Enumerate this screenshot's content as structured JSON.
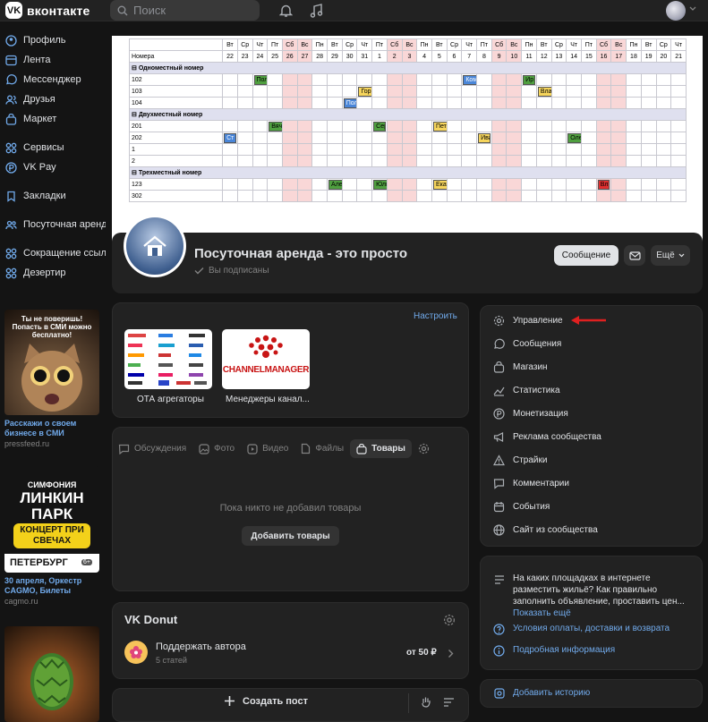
{
  "topbar": {
    "logo_letter": "VK",
    "logo_text": "вконтакте",
    "search_placeholder": "Поиск"
  },
  "sidebar": {
    "items": [
      {
        "label": "Профиль",
        "icon": "profile-icon"
      },
      {
        "label": "Лента",
        "icon": "feed-icon"
      },
      {
        "label": "Мессенджер",
        "icon": "messenger-icon"
      },
      {
        "label": "Друзья",
        "icon": "friends-icon"
      },
      {
        "label": "Маркет",
        "icon": "market-icon"
      },
      {
        "label": "Сервисы",
        "icon": "services-icon"
      },
      {
        "label": "VK Pay",
        "icon": "vkpay-icon"
      },
      {
        "label": "Закладки",
        "icon": "bookmark-icon"
      },
      {
        "label": "Посуточная аренда",
        "icon": "community-icon"
      },
      {
        "label": "Сокращение ссылок",
        "icon": "shortlink-icon"
      },
      {
        "label": "Дезертир",
        "icon": "apps-icon"
      }
    ]
  },
  "ads": [
    {
      "image_text": "Ты не поверишь! Попасть в СМИ можно бесплатно!",
      "title": "Расскажи о своем бизнесе в СМИ",
      "domain": "pressfeed.ru"
    },
    {
      "image_text": {
        "line1": "СИМФОНИЯ",
        "line2": "ЛИНКИН",
        "line3": "ПАРК",
        "line4": "КОНЦЕРТ ПРИ СВЕЧАХ",
        "line5": "ПЕТЕРБУРГ",
        "age": "6+"
      },
      "title": "30 апреля, Оркестр CAGMO, Билеты",
      "domain": "cagmo.ru"
    }
  ],
  "calendar": {
    "weekdays": [
      "Вт",
      "Ср",
      "Чт",
      "Пт",
      "Сб",
      "Вс",
      "Пн",
      "Вт",
      "Ср",
      "Чт",
      "Пт",
      "Сб",
      "Вс",
      "Пн",
      "Вт",
      "Ср",
      "Чт",
      "Пт",
      "Сб",
      "Вс",
      "Пн",
      "Вт",
      "Ср",
      "Чт",
      "Пт",
      "Сб",
      "Вс",
      "Пн",
      "Вт",
      "Ср",
      "Чт"
    ],
    "days": [
      "22",
      "23",
      "24",
      "25",
      "26",
      "27",
      "28",
      "29",
      "30",
      "31",
      "1",
      "2",
      "3",
      "4",
      "5",
      "6",
      "7",
      "8",
      "9",
      "10",
      "11",
      "12",
      "13",
      "14",
      "15",
      "16",
      "17",
      "18",
      "19",
      "20",
      "21"
    ],
    "weekend_indexes": [
      4,
      5,
      11,
      12,
      18,
      19,
      25,
      26
    ],
    "rooms_header": "Номера",
    "rows": [
      {
        "type": "group",
        "label": "Одноместный номер"
      },
      {
        "type": "room",
        "label": "102",
        "bookings": [
          {
            "text": "Полева Алекс",
            "start": 2,
            "span": 3,
            "color": "g"
          },
          {
            "text": "Комов Роман",
            "start": 16,
            "span": 3,
            "color": "b"
          },
          {
            "text": "Ир",
            "start": 20,
            "span": 1,
            "color": "g"
          }
        ]
      },
      {
        "type": "room",
        "label": "103",
        "bookings": [
          {
            "text": "Горкунов",
            "start": 9,
            "span": 2,
            "color": "y"
          },
          {
            "text": "Владимир",
            "start": 21,
            "span": 4,
            "color": "y"
          }
        ]
      },
      {
        "type": "room",
        "label": "104",
        "bookings": [
          {
            "text": "Полева Александр",
            "start": 8,
            "span": 4,
            "color": "b"
          }
        ]
      },
      {
        "type": "group",
        "label": "Двухместный номер"
      },
      {
        "type": "room",
        "label": "201",
        "bookings": [
          {
            "text": "Вячеслав",
            "start": 3,
            "span": 4,
            "color": "g"
          },
          {
            "text": "Сер",
            "start": 10,
            "span": 1,
            "color": "g"
          },
          {
            "text": "Петр",
            "start": 14,
            "span": 3,
            "color": "y"
          }
        ]
      },
      {
        "type": "room",
        "label": "202",
        "bookings": [
          {
            "text": "Ст",
            "start": 0,
            "span": 1,
            "color": "b"
          },
          {
            "text": "Ива",
            "start": 17,
            "span": 1,
            "color": "y"
          },
          {
            "text": "Олег",
            "start": 23,
            "span": 4,
            "color": "g"
          }
        ]
      },
      {
        "type": "room",
        "label": "1",
        "bookings": []
      },
      {
        "type": "room",
        "label": "2",
        "bookings": []
      },
      {
        "type": "group",
        "label": "Трехместный номер"
      },
      {
        "type": "room",
        "label": "123",
        "bookings": [
          {
            "text": "Алексан",
            "start": 7,
            "span": 2,
            "color": "g"
          },
          {
            "text": "Юлия",
            "start": 10,
            "span": 3,
            "color": "g"
          },
          {
            "text": "Екатерина",
            "start": 14,
            "span": 4,
            "color": "y"
          },
          {
            "text": "Вл",
            "start": 25,
            "span": 1,
            "color": "r"
          }
        ]
      },
      {
        "type": "room",
        "label": "302",
        "bookings": []
      }
    ]
  },
  "group": {
    "title": "Посуточная аренда - это просто",
    "subscribed": "Вы подписаны",
    "btn_message": "Сообщение",
    "btn_more": "Ещё"
  },
  "links_block": {
    "configure": "Настроить",
    "tiles": [
      {
        "label": "ОТА агрегаторы"
      },
      {
        "label": "Менеджеры канал...",
        "logo_text": "CHANNELMANAGER"
      }
    ]
  },
  "tabs": [
    {
      "label": "Обсуждения",
      "icon": "discussions-icon",
      "active": false
    },
    {
      "label": "Фото",
      "icon": "photo-icon",
      "active": false
    },
    {
      "label": "Видео",
      "icon": "video-icon",
      "active": false
    },
    {
      "label": "Файлы",
      "icon": "files-icon",
      "active": false
    },
    {
      "label": "Товары",
      "icon": "goods-icon",
      "active": true
    }
  ],
  "goods": {
    "empty_text": "Пока никто не добавил товары",
    "add_button": "Добавить товары"
  },
  "donut": {
    "title": "VK Donut",
    "action": "Поддержать автора",
    "posts": "5 статей",
    "price": "от 50 ₽"
  },
  "create_post": "Создать пост",
  "management": {
    "items": [
      {
        "label": "Управление",
        "icon": "gear-icon"
      },
      {
        "label": "Сообщения",
        "icon": "message-icon"
      },
      {
        "label": "Магазин",
        "icon": "shop-icon"
      },
      {
        "label": "Статистика",
        "icon": "stats-icon"
      },
      {
        "label": "Монетизация",
        "icon": "money-icon"
      },
      {
        "label": "Реклама сообщества",
        "icon": "megaphone-icon"
      },
      {
        "label": "Страйки",
        "icon": "warning-icon"
      },
      {
        "label": "Комментарии",
        "icon": "comment-icon"
      },
      {
        "label": "События",
        "icon": "event-icon"
      },
      {
        "label": "Сайт из сообщества",
        "icon": "globe-icon"
      }
    ],
    "arrow_color": "#e02020"
  },
  "info": {
    "text": "На каких площадках в интернете разместить жильё? Как правильно заполнить объявление, проставить цен...",
    "show_all": "Показать ещё",
    "link1": "Условия оплаты, доставки и возврата",
    "link2": "Подробная информация"
  },
  "story": "Добавить историю",
  "colors": {
    "accent": "#71aaeb",
    "bg": "#141414",
    "card": "#222222"
  }
}
